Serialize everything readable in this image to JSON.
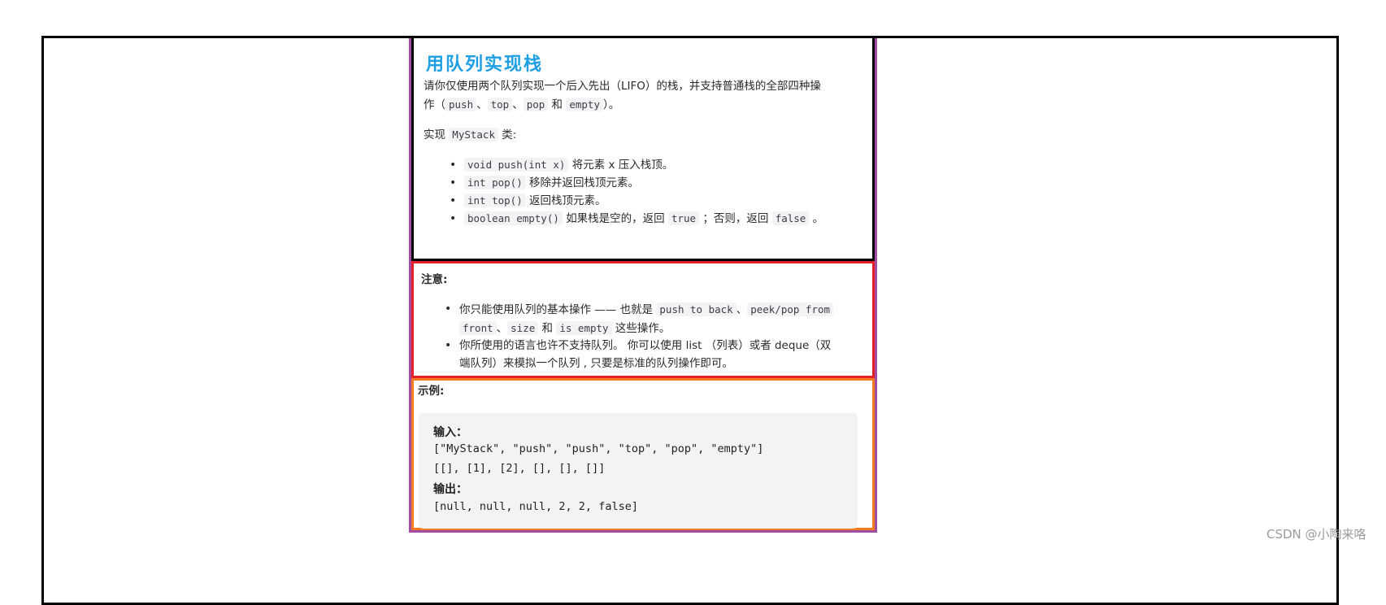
{
  "problem": {
    "title": "用队列实现栈",
    "intro_line1": "请你仅使用两个队列实现一个后入先出（LIFO）的栈，并支持普通栈的全部四种操",
    "intro_line2_prefix": "作（",
    "intro_codes": [
      "push",
      "top",
      "pop",
      "empty"
    ],
    "intro_seps": [
      "、",
      "、",
      " 和 "
    ],
    "intro_line2_suffix": "）。",
    "implement_prefix": "实现 ",
    "implement_class": "MyStack",
    "implement_suffix": " 类:",
    "methods": [
      {
        "code": "void push(int x)",
        "desc": "将元素 x 压入栈顶。"
      },
      {
        "code": "int pop()",
        "desc": "移除并返回栈顶元素。"
      },
      {
        "code": "int top()",
        "desc": "返回栈顶元素。"
      },
      {
        "code": "boolean empty()",
        "desc": "如果栈是空的，返回",
        "code2": "true",
        "mid": "；否则，返回",
        "code3": "false",
        "end": "。"
      }
    ]
  },
  "notes": {
    "heading": "注意:",
    "item1_text": "你只能使用队列的基本操作 —— 也就是",
    "item1_code1": "push to back",
    "item1_sep1": "、",
    "item1_code2": "peek/pop from",
    "item1_code2b": "front",
    "item1_sep2": "、",
    "item1_code3": "size",
    "item1_sep3": " 和 ",
    "item1_code4": "is empty",
    "item1_end": " 这些操作。",
    "item2_line1": "你所使用的语言也许不支持队列。 你可以使用 list （列表）或者 deque（双",
    "item2_line2": "端队列）来模拟一个队列 , 只要是标准的队列操作即可。"
  },
  "example": {
    "heading": "示例:",
    "input_label": "输入：",
    "input_line1": "[\"MyStack\", \"push\", \"push\", \"top\", \"pop\", \"empty\"]",
    "input_line2": "[[], [1], [2], [], [], []]",
    "output_label": "输出：",
    "output_line": "[null, null, null, 2, 2, false]"
  },
  "watermark": "CSDN @小陶来咯",
  "colors": {
    "title": "#1e9fe4",
    "container_border": "#a24ca3",
    "desc_border": "#000000",
    "note_border": "#e5202a",
    "example_border": "#f47c20"
  }
}
